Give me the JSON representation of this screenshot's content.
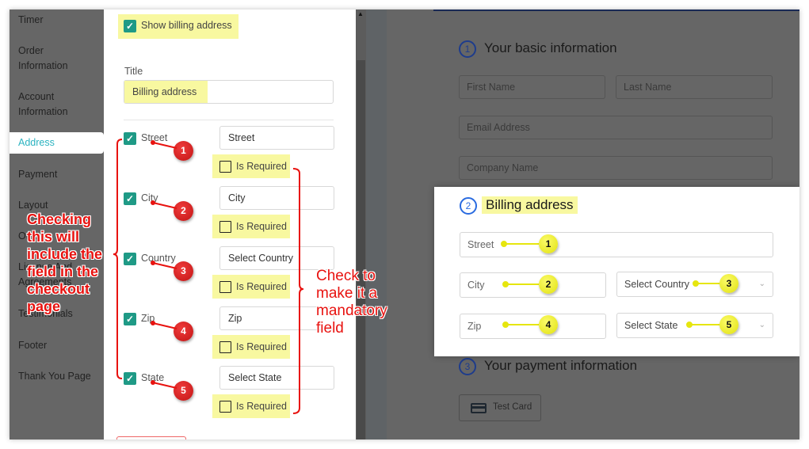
{
  "sidebar": {
    "items": [
      {
        "label": "Timer"
      },
      {
        "label": "Order Information"
      },
      {
        "label": "Account Information"
      },
      {
        "label": "Address",
        "active": true
      },
      {
        "label": "Payment"
      },
      {
        "label": "Layout"
      },
      {
        "label": "Other"
      },
      {
        "label": "License And Agreements"
      },
      {
        "label": "Testimonials"
      },
      {
        "label": "Footer"
      },
      {
        "label": "Thank You Page"
      }
    ]
  },
  "settings": {
    "show_billing_label": "Show billing address",
    "show_billing_checked": true,
    "title_label": "Title",
    "title_value": "Billing address",
    "fields": [
      {
        "label": "Street",
        "enabled": true,
        "input_value": "Street",
        "required_label": "Is Required",
        "required": false,
        "badge": "1"
      },
      {
        "label": "City",
        "enabled": true,
        "input_value": "City",
        "required_label": "Is Required",
        "required": false,
        "badge": "2"
      },
      {
        "label": "Country",
        "enabled": true,
        "input_value": "Select Country",
        "required_label": "Is Required",
        "required": false,
        "badge": "3"
      },
      {
        "label": "Zip",
        "enabled": true,
        "input_value": "Zip",
        "required_label": "Is Required",
        "required": false,
        "badge": "4"
      },
      {
        "label": "State",
        "enabled": true,
        "input_value": "Select State",
        "required_label": "Is Required",
        "required": false,
        "badge": "5"
      }
    ],
    "check_mark": "✓"
  },
  "preview": {
    "section1": {
      "num": "1",
      "title": "Your basic information",
      "fields": {
        "first_name": "First Name",
        "last_name": "Last Name",
        "email": "Email Address",
        "company": "Company Name"
      }
    },
    "section2": {
      "num": "2",
      "title": "Billing address",
      "fields": {
        "street": "Street",
        "city": "City",
        "country": "Select Country",
        "zip": "Zip",
        "state": "Select State"
      },
      "badges": {
        "street": "1",
        "city": "2",
        "country": "3",
        "zip": "4",
        "state": "5"
      }
    },
    "section3": {
      "num": "3",
      "title": "Your payment information",
      "payment_button": "Test Card"
    },
    "chevron": "⌄"
  },
  "annotations": {
    "left_note": "Checking this will include the field in the checkout page",
    "right_note": "Check to make it a mandatory field",
    "color_red": "#e8120f",
    "color_yellow": "#f8f8a0"
  },
  "scrollbar": {
    "up_arrow": "▲"
  }
}
